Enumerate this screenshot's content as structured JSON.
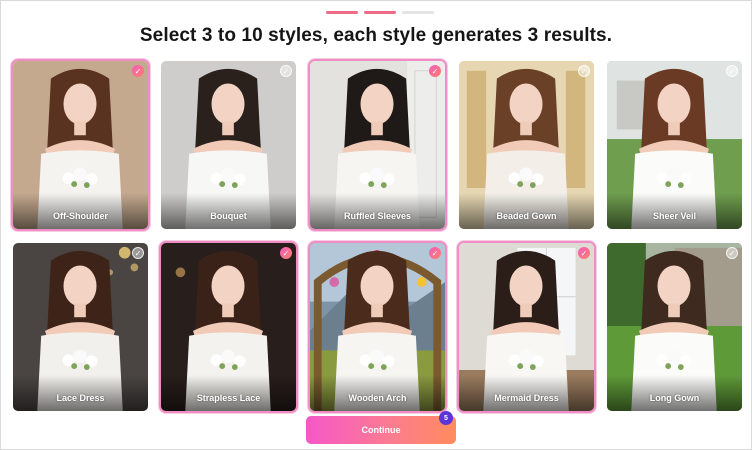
{
  "progress": {
    "steps": 3,
    "current": 2
  },
  "heading": "Select 3 to 10 styles, each style generates 3 results.",
  "styles": [
    {
      "label": "Off-Shoulder",
      "selected": true,
      "bg": "#c4a98f",
      "dress": "#f5f3f0",
      "hair": "#5a3320",
      "scene": "studio-warm"
    },
    {
      "label": "Bouquet",
      "selected": false,
      "bg": "#cfcdcb",
      "dress": "#f7f7f6",
      "hair": "#2a211d",
      "scene": "studio-grey"
    },
    {
      "label": "Ruffled Sleeves",
      "selected": true,
      "bg": "#e3e2df",
      "dress": "#f6f5f2",
      "hair": "#1f1a17",
      "scene": "white-room"
    },
    {
      "label": "Beaded Gown",
      "selected": false,
      "bg": "#d8c49a",
      "dress": "#f3efe8",
      "hair": "#6a4127",
      "scene": "palace"
    },
    {
      "label": "Sheer Veil",
      "selected": false,
      "bg": "#7da26a",
      "dress": "#fbfbf9",
      "hair": "#6b3a24",
      "scene": "garden"
    },
    {
      "label": "Lace Dress",
      "selected": false,
      "bg": "#4a4542",
      "dress": "#f2f0ec",
      "hair": "#3e2418",
      "scene": "dark-lights"
    },
    {
      "label": "Strapless Lace",
      "selected": true,
      "bg": "#2f2420",
      "dress": "#f4f2ee",
      "hair": "#3b2218",
      "scene": "dark-room"
    },
    {
      "label": "Wooden Arch",
      "selected": true,
      "bg": "#7c93a8",
      "dress": "#f7f5f2",
      "hair": "#4b2b1c",
      "scene": "arch"
    },
    {
      "label": "Mermaid Dress",
      "selected": true,
      "bg": "#dedbd5",
      "dress": "#f8f7f4",
      "hair": "#2b1e18",
      "scene": "window-room"
    },
    {
      "label": "Long Gown",
      "selected": false,
      "bg": "#5d8a3f",
      "dress": "#fbfbfa",
      "hair": "#3e2a1e",
      "scene": "lawn"
    }
  ],
  "continue_label": "Continue",
  "selected_count": "5",
  "colors": {
    "accent_start": "#f657c8",
    "accent_end": "#ff8c5d",
    "badge": "#5b35d6",
    "selected_border": "#ef8ec4"
  }
}
